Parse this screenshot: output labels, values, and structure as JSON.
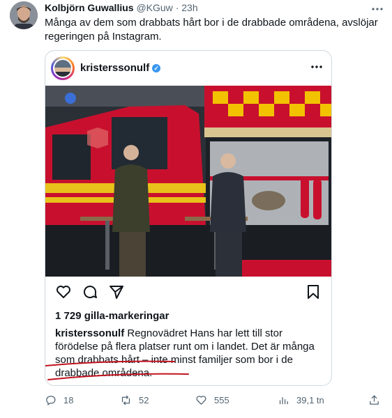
{
  "tweet": {
    "author_name": "Kolbjörn Guwallius",
    "handle": "@KGuw",
    "separator": "·",
    "time": "23h",
    "text": "Många av dem som drabbats hårt bor i de drabbade områdena, avslöjar regeringen på Instagram.",
    "more_icon": "more-horizontal-icon"
  },
  "embed": {
    "username": "kristerssonulf",
    "likes": "1 729 gilla-markeringar",
    "caption_user": "kristerssonulf",
    "caption_text": "Regnovädret Hans har lett till stor förödelse på flera platser runt om i landet. Det är många som drabbats hårt – inte minst familjer som bor i de drabbade områdena.",
    "icons": [
      "heart-icon",
      "comment-icon",
      "share-icon",
      "bookmark-icon"
    ]
  },
  "footer": {
    "replies": "18",
    "retweets": "52",
    "likes": "555",
    "views": "39,1 tn"
  },
  "colors": {
    "accent": "#1d9bf0",
    "underline": "#c1121f",
    "fire_truck": "#c8102e",
    "muted": "#536471"
  }
}
